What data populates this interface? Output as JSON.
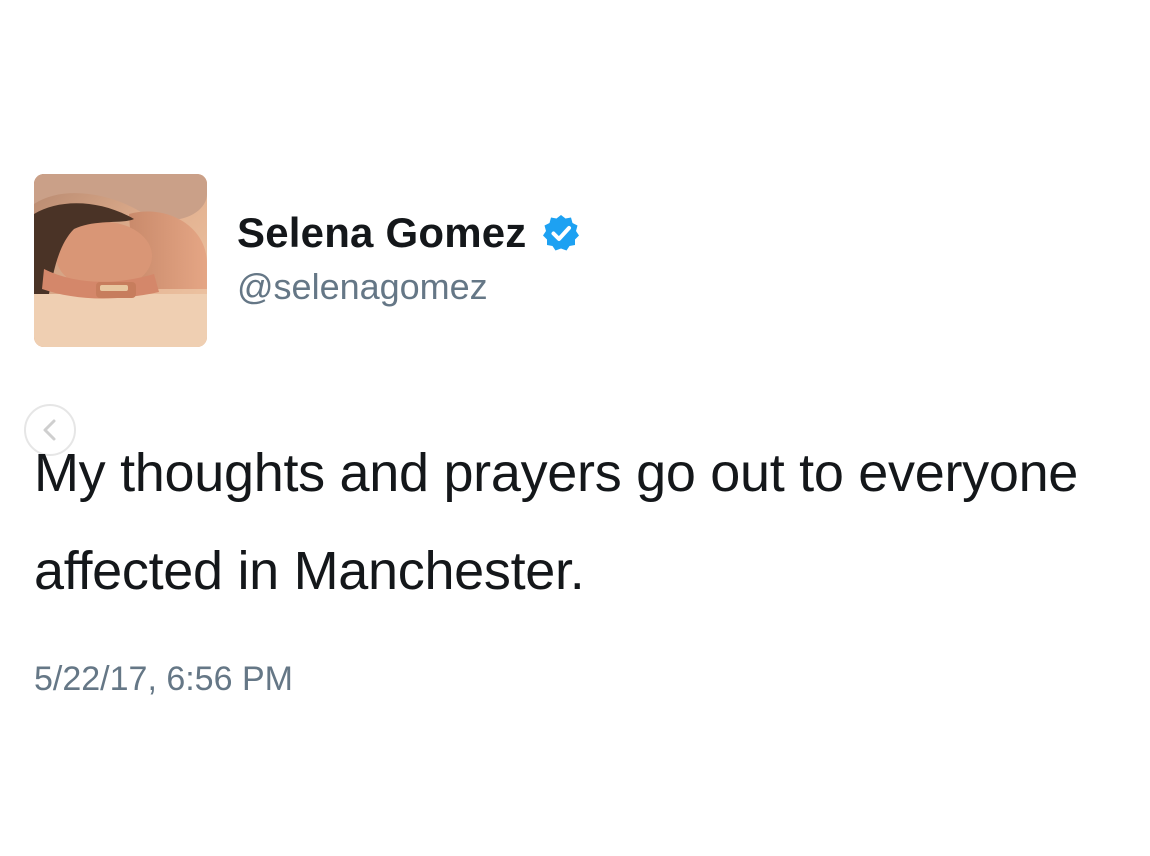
{
  "tweet": {
    "author": {
      "display_name": "Selena Gomez",
      "handle": "@selenagomez",
      "verified": true,
      "avatar_icon": "profile-photo",
      "verified_icon": "verified-badge-icon"
    },
    "text": "My thoughts and prayers go out to everyone affected in Manchester.",
    "timestamp": "5/22/17, 6:56 PM"
  },
  "colors": {
    "text_primary": "#14171a",
    "text_secondary": "#657786",
    "verified_blue": "#1da1f2",
    "background": "#ffffff"
  }
}
